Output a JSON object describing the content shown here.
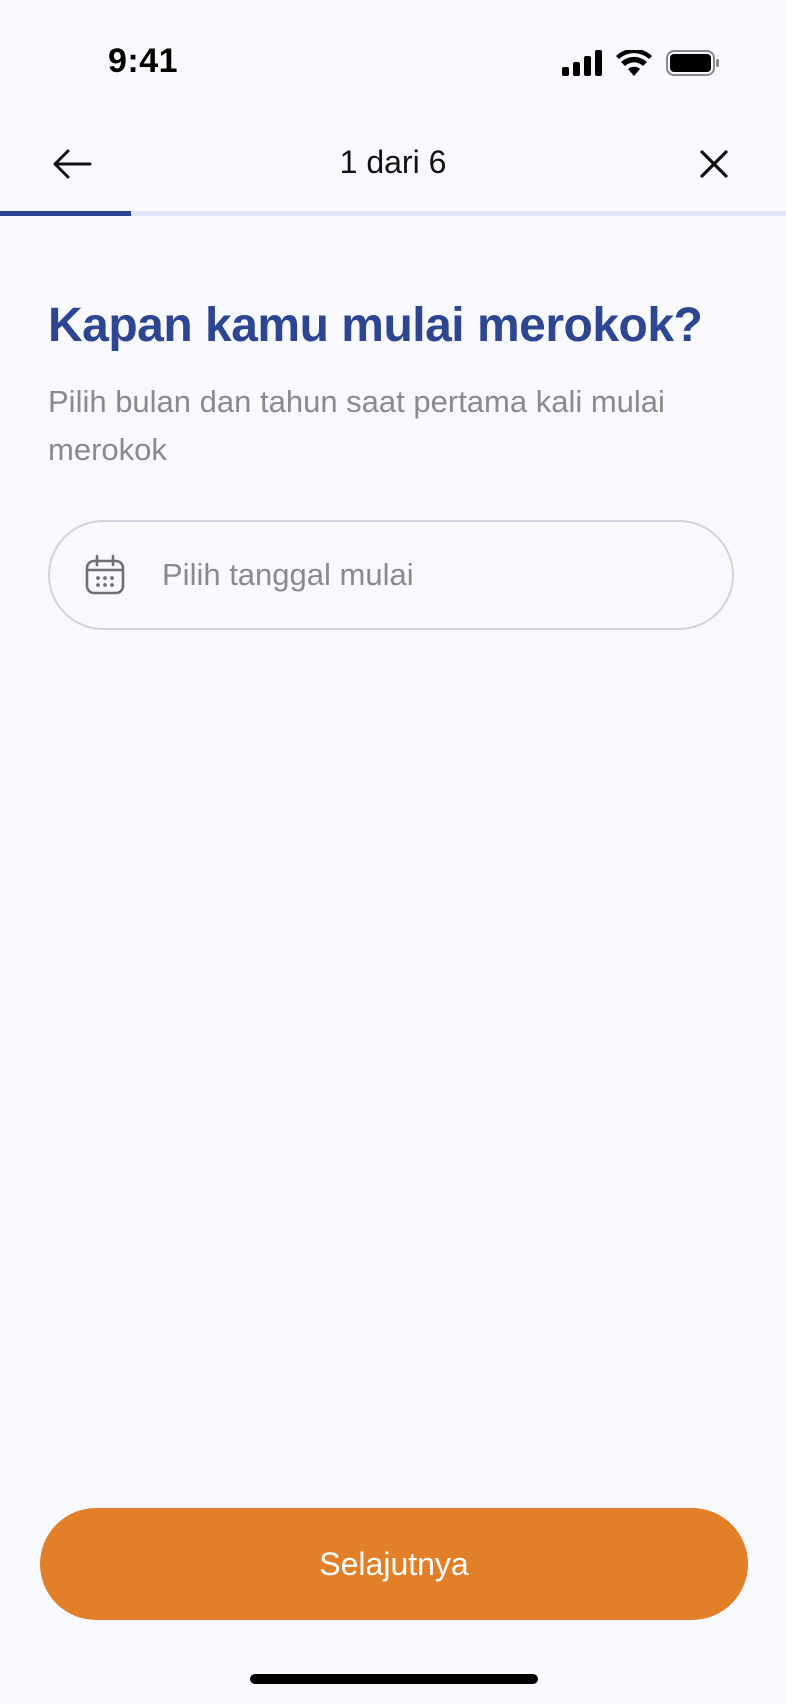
{
  "status_bar": {
    "time": "9:41",
    "icons": [
      "cellular-signal-icon",
      "wifi-icon",
      "battery-icon"
    ]
  },
  "nav": {
    "back_icon": "arrow-left-icon",
    "step_label": "1 dari 6",
    "close_icon": "close-icon"
  },
  "progress": {
    "current_step": 1,
    "total_steps": 6,
    "fraction": 0.1667,
    "fill_color": "#2e4692",
    "track_color": "#dfe6f6"
  },
  "question": {
    "title": "Kapan kamu mulai merokok?",
    "subtitle": "Pilih bulan dan tahun saat pertama kali mulai merokok"
  },
  "date_field": {
    "icon": "calendar-icon",
    "placeholder": "Pilih tanggal mulai",
    "value": ""
  },
  "footer": {
    "next_label": "Selajutnya"
  },
  "colors": {
    "accent": "#2e4692",
    "primary_button": "#e2802a",
    "background": "#f7f9fd",
    "muted_text": "#8a8a8e"
  }
}
